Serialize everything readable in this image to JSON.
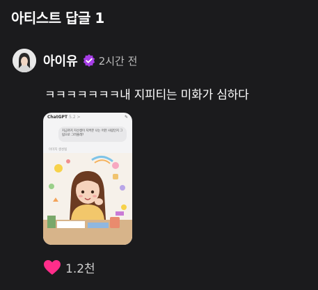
{
  "header": {
    "title": "아티스트 답글 1"
  },
  "post": {
    "author": "아이유",
    "timestamp": "2시간 전",
    "text": "ㅋㅋㅋㅋㅋㅋㅋ내 지피티는 미화가 심하다",
    "likes": "1.2천",
    "verified_color": "#a63de6",
    "heart_color": "#ff2d8a"
  },
  "attachment": {
    "app_title": "ChatGPT",
    "app_version": "5.2 >",
    "prompt": "지금까지 지선생이 지켜본 나는 어떤 사람인지 그림으로 그려줄래?",
    "image_label": "이미지 생성됨"
  }
}
